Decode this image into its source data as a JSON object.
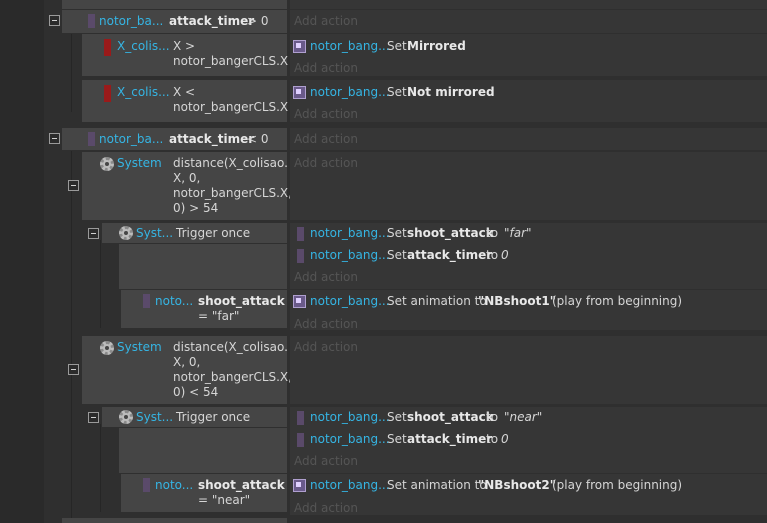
{
  "ev1": {
    "obj": "notor_ba...",
    "cond_var": "attack_timer",
    "cond_op": "> 0",
    "add_action": "Add action",
    "sub": [
      {
        "obj": "X_colis...",
        "expr1": "X >",
        "expr2": "notor_bangerCLS.X",
        "act_obj": "notor_bang...",
        "act_set": "Set",
        "act_val": "Mirrored",
        "add_action": "Add action"
      },
      {
        "obj": "X_colis...",
        "expr1": "X <",
        "expr2": "notor_bangerCLS.X",
        "act_obj": "notor_bang...",
        "act_set": "Set",
        "act_val": "Not mirrored",
        "add_action": "Add action"
      }
    ]
  },
  "ev2": {
    "obj": "notor_ba...",
    "cond_var": "attack_timer",
    "cond_op": "< 0",
    "add_action": "Add action",
    "far": {
      "obj": "System",
      "lines": [
        "distance(X_colisao.",
        "X, 0,",
        "notor_bangerCLS.X,",
        "0) > 54"
      ],
      "add_action": "Add action",
      "trig_obj": "Syst...",
      "trig_text": "Trigger once",
      "a1": {
        "obj": "notor_bang...",
        "pre": "Set",
        "var": "shoot_attack",
        "mid": "to",
        "val": "\"far\""
      },
      "a2": {
        "obj": "notor_bang...",
        "pre": "Set",
        "var": "attack_timer",
        "mid": "to",
        "val": "0"
      },
      "add_action2": "Add action",
      "sub_obj": "noto...",
      "sub_var": "shoot_attack",
      "sub_val": "= \"far\"",
      "a3": {
        "obj": "notor_bang...",
        "pre": "Set animation to",
        "var": "\"NBshoot1\"",
        "post": "(play from beginning)"
      },
      "add_action3": "Add action"
    },
    "near": {
      "obj": "System",
      "lines": [
        "distance(X_colisao.",
        "X, 0,",
        "notor_bangerCLS.X,",
        "0) < 54"
      ],
      "add_action": "Add action",
      "trig_obj": "Syst...",
      "trig_text": "Trigger once",
      "a1": {
        "obj": "notor_bang...",
        "pre": "Set",
        "var": "shoot_attack",
        "mid": "to",
        "val": "\"near\""
      },
      "a2": {
        "obj": "notor_bang...",
        "pre": "Set",
        "var": "attack_timer",
        "mid": "to",
        "val": "0"
      },
      "add_action2": "Add action",
      "sub_obj": "noto...",
      "sub_var": "shoot_attack",
      "sub_val": "= \"near\"",
      "a3": {
        "obj": "notor_bang...",
        "pre": "Set animation to",
        "var": "\"NBshoot2\"",
        "post": "(play from beginning)"
      },
      "add_action3": "Add action"
    }
  },
  "colors": {
    "object": "#35b5e4",
    "background": "#2f2f2f",
    "condition": "#454545",
    "action": "#363636",
    "instance_swatch": "#5a4a6a",
    "sprite_swatch": "#9a1a1a"
  },
  "icons": {
    "system": "gear-icon",
    "sprite_action": "sprite-icon",
    "instance_swatch": "color-swatch",
    "sprite_swatch": "sprite-swatch-icon",
    "collapse": "collapse-toggle-icon"
  }
}
